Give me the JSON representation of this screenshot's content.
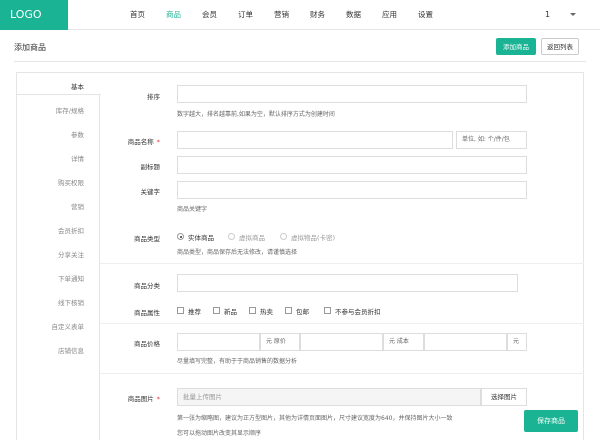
{
  "header": {
    "logo": "LOGO",
    "nav": [
      "首页",
      "商品",
      "会员",
      "订单",
      "营销",
      "财务",
      "数据",
      "应用",
      "设置"
    ],
    "active_nav": "商品",
    "user": "1"
  },
  "page": {
    "title": "添加商品",
    "add_button": "添加商品",
    "back_button": "返回列表"
  },
  "sidebar": {
    "items": [
      "基本",
      "库存/规格",
      "参数",
      "详情",
      "购买权限",
      "营销",
      "会员折扣",
      "分享关注",
      "下单通知",
      "线下核销",
      "自定义表单",
      "店铺信息"
    ]
  },
  "form": {
    "sort": {
      "label": "排序",
      "value": "",
      "help": "数字越大，排名越靠前,如果为空，默认排序方式为创建时间"
    },
    "name": {
      "label": "商品名称",
      "required": "*",
      "value": "",
      "unit_placeholder": "单位, 如: 个/件/包"
    },
    "subtitle": {
      "label": "副标题",
      "value": ""
    },
    "keywords": {
      "label": "关键字",
      "value": "",
      "help": "商品关键字"
    },
    "type": {
      "label": "商品类型",
      "options": [
        "实体商品",
        "虚拟商品",
        "虚拟物品(卡密)"
      ],
      "selected": "实体商品",
      "help": "商品类型，商品保存后无法修改，请谨慎选择"
    },
    "category": {
      "label": "商品分类",
      "value": ""
    },
    "attributes": {
      "label": "商品属性",
      "options": [
        "推荐",
        "新品",
        "热卖",
        "包邮",
        "不参与会员折扣"
      ]
    },
    "price": {
      "label": "商品价格",
      "unit1": "元 原价",
      "unit2": "元 成本",
      "unit3": "元",
      "help": "尽量填写完整，有助于于商品销售的数据分析"
    },
    "images": {
      "label": "商品图片",
      "required": "*",
      "placeholder": "批量上传图片",
      "button": "选择图片",
      "help1": "第一张为缩略图，建议为正方型图片，其他为详情页面图片，尺寸建议宽度为640，并保持图片大小一致",
      "help2": "您可以拖动图片改变其显示顺序"
    }
  },
  "save_button": "保存商品",
  "colors": {
    "accent": "#1ab394",
    "required": "#e33333"
  }
}
